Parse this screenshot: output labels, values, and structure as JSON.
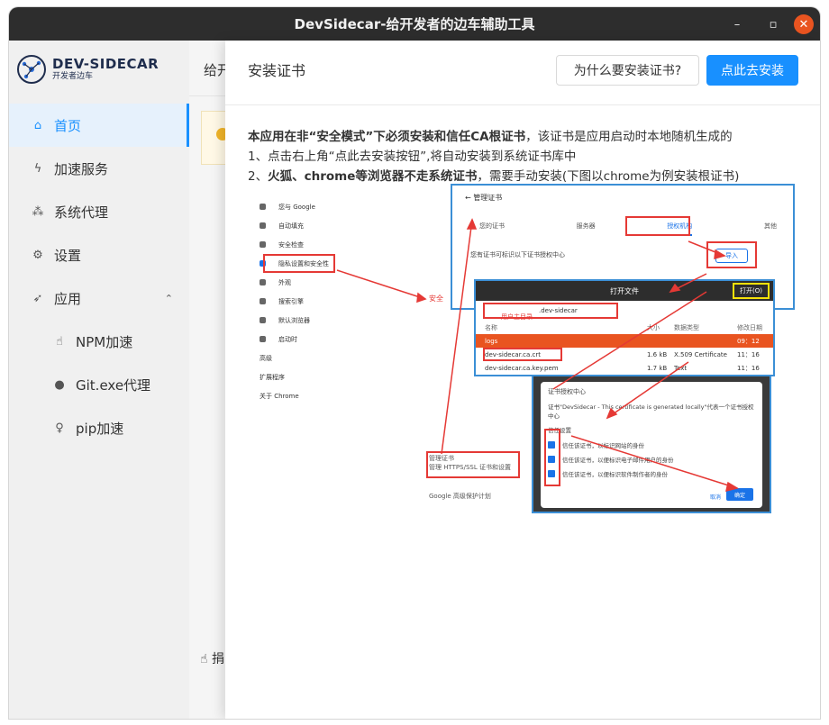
{
  "window": {
    "title": "DevSidecar-给开发者的边车辅助工具"
  },
  "sidebar": {
    "logo": {
      "main": "DEV-SIDECAR",
      "sub": "开发者边车"
    },
    "items": [
      {
        "label": "首页",
        "icon": "home-icon"
      },
      {
        "label": "加速服务",
        "icon": "lightning-icon"
      },
      {
        "label": "系统代理",
        "icon": "network-icon"
      },
      {
        "label": "设置",
        "icon": "gear-icon"
      },
      {
        "label": "应用",
        "icon": "rocket-icon"
      },
      {
        "label": "NPM加速",
        "icon": "thumbs-up-icon"
      },
      {
        "label": "Git.exe代理",
        "icon": "github-icon"
      },
      {
        "label": "pip加速",
        "icon": "bulb-icon"
      }
    ]
  },
  "background": {
    "header_text": "给开",
    "footer_text": "捐"
  },
  "drawer": {
    "title": "安装证书",
    "why_button": "为什么要安装证书?",
    "install_button": "点此去安装",
    "line1_bold": "本应用在非“安全模式”下必须安装和信任CA根证书",
    "line1_rest": "，该证书是应用启动时本地随机生成的",
    "line2": "1、点击右上角“点此去安装按钮”,将自动安装到系统证书库中",
    "line3_prefix": "2、",
    "line3_bold": "火狐、chrome等浏览器不走系统证书",
    "line3_rest": "，需要手动安装(下图以chrome为例安装根证书)"
  },
  "figure": {
    "settings_items": [
      "您与 Google",
      "自动填充",
      "安全检查",
      "隐私设置和安全性",
      "外观",
      "搜索引擎",
      "默认浏览器",
      "启动时"
    ],
    "settings_extra": [
      "高级",
      "扩展程序",
      "关于 Chrome"
    ],
    "manage_cert": "管理证书",
    "manage_cert_sub": "管理 HTTPS/SSL 证书和设置",
    "safe": "安全",
    "google_protect": "Google 高级保护计划",
    "cert_mgr_title": "管理证书",
    "cert_tabs": [
      "您的证书",
      "服务器",
      "授权机构",
      "其他"
    ],
    "cert_desc": "您有证书可标识以下证书授权中心",
    "import": "导入",
    "file_dialog_title": "打开文件",
    "file_path": ".dev-sidecar",
    "user_home": "用户主目录",
    "open_btn": "打开(O)",
    "cols": [
      "名称",
      "大小",
      "修改日期"
    ],
    "col_type": "数据类型",
    "files": [
      {
        "name": "logs",
        "size": "",
        "type": "",
        "date": "09：12"
      },
      {
        "name": "dev-sidecar.ca.crt",
        "size": "1.6 kB",
        "type": "X.509 Certificate",
        "date": "11：16"
      },
      {
        "name": "dev-sidecar.ca.key.pem",
        "size": "1.7 kB",
        "type": "Text",
        "date": "11：16"
      }
    ],
    "ca_title": "证书授权中心",
    "ca_desc": "证书\"DevSidecar - This certificate is generated locally\"代表一个证书授权中心",
    "trust_label": "信任设置",
    "trust_items": [
      "信任该证书，以标识网站的身份",
      "信任该证书，以便标识电子邮件用户的身份",
      "信任该证书，以便标识软件制作者的身份"
    ],
    "cancel": "取消",
    "ok": "确定"
  }
}
